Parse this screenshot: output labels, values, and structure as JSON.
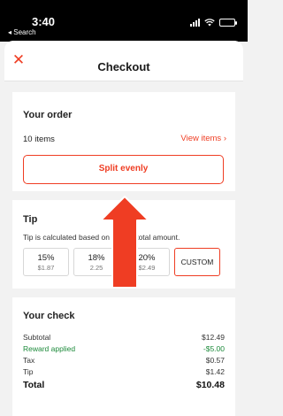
{
  "status_bar": {
    "time": "3:40",
    "back_label": "◂ Search"
  },
  "header": {
    "title": "Checkout",
    "close_glyph": "✕"
  },
  "order": {
    "title": "Your order",
    "items_count": "10 items",
    "view_items_label": "View items",
    "view_items_chevron": "›",
    "split_button_label": "Split evenly"
  },
  "tip": {
    "title": "Tip",
    "description": "Tip is calculated based on the subtotal amount.",
    "options": [
      {
        "percent": "15%",
        "amount": "$1.87"
      },
      {
        "percent": "18%",
        "amount": "2.25"
      },
      {
        "percent": "20%",
        "amount": "$2.49"
      }
    ],
    "custom_label": "CUSTOM"
  },
  "check": {
    "title": "Your check",
    "rows": [
      {
        "label": "Subtotal",
        "value": "$12.49"
      },
      {
        "label": "Reward applied",
        "value": "-$5.00"
      },
      {
        "label": "Tax",
        "value": "$0.57"
      },
      {
        "label": "Tip",
        "value": "$1.42"
      }
    ],
    "total_label": "Total",
    "total_value": "$10.48"
  },
  "colors": {
    "accent": "#ef3d23",
    "reward": "#1c8a3a"
  }
}
